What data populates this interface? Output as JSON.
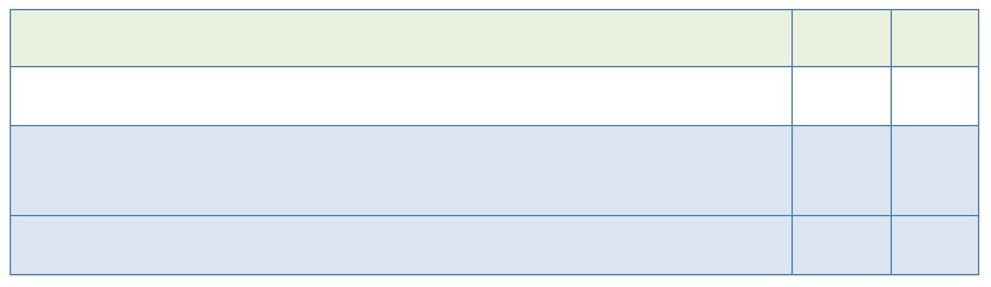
{
  "table": {
    "rows": [
      {
        "cells": [
          "",
          "",
          ""
        ],
        "fill": "#ebf1de"
      },
      {
        "cells": [
          "",
          "",
          ""
        ],
        "fill": "#ffffff"
      },
      {
        "cells": [
          "",
          "",
          ""
        ],
        "fill": "#dce6f1"
      },
      {
        "cells": [
          "",
          "",
          ""
        ],
        "fill": "#dce6f1"
      }
    ],
    "border_color": "#4f7fb8"
  }
}
